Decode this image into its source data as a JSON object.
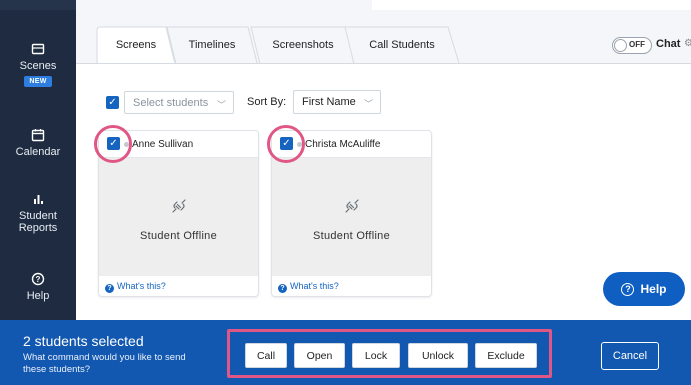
{
  "sidebar": {
    "items": [
      {
        "label": "Scenes",
        "badge": "NEW",
        "icon": "scenes-icon"
      },
      {
        "label": "Calendar",
        "icon": "calendar-icon"
      },
      {
        "label_line1": "Student",
        "label_line2": "Reports",
        "icon": "bar-chart-icon"
      },
      {
        "label": "Help",
        "icon": "help-icon"
      }
    ]
  },
  "tabs": [
    {
      "label": "Screens",
      "active": true
    },
    {
      "label": "Timelines"
    },
    {
      "label": "Screenshots"
    },
    {
      "label": "Call Students"
    }
  ],
  "chat": {
    "toggle_state": "OFF",
    "label": "Chat"
  },
  "toolbar": {
    "select_placeholder": "Select students",
    "sort_label": "Sort By:",
    "sort_value": "First Name"
  },
  "students": [
    {
      "name": "Anne Sullivan",
      "status": "Student Offline",
      "help_link": "What's this?",
      "checked": true
    },
    {
      "name": "Christa McAuliffe",
      "status": "Student Offline",
      "help_link": "What's this?",
      "checked": true
    }
  ],
  "help_button": {
    "label": "Help"
  },
  "bottom_bar": {
    "selected_text": "2 students selected",
    "prompt": "What command would you like to send these students?",
    "commands": [
      "Call",
      "Open",
      "Lock",
      "Unlock",
      "Exclude"
    ],
    "cancel_label": "Cancel"
  },
  "colors": {
    "sidebar": "#1e2b40",
    "accent_blue": "#1565c0",
    "bottom_bar": "#1257b0",
    "highlight_pink": "#e05786"
  }
}
